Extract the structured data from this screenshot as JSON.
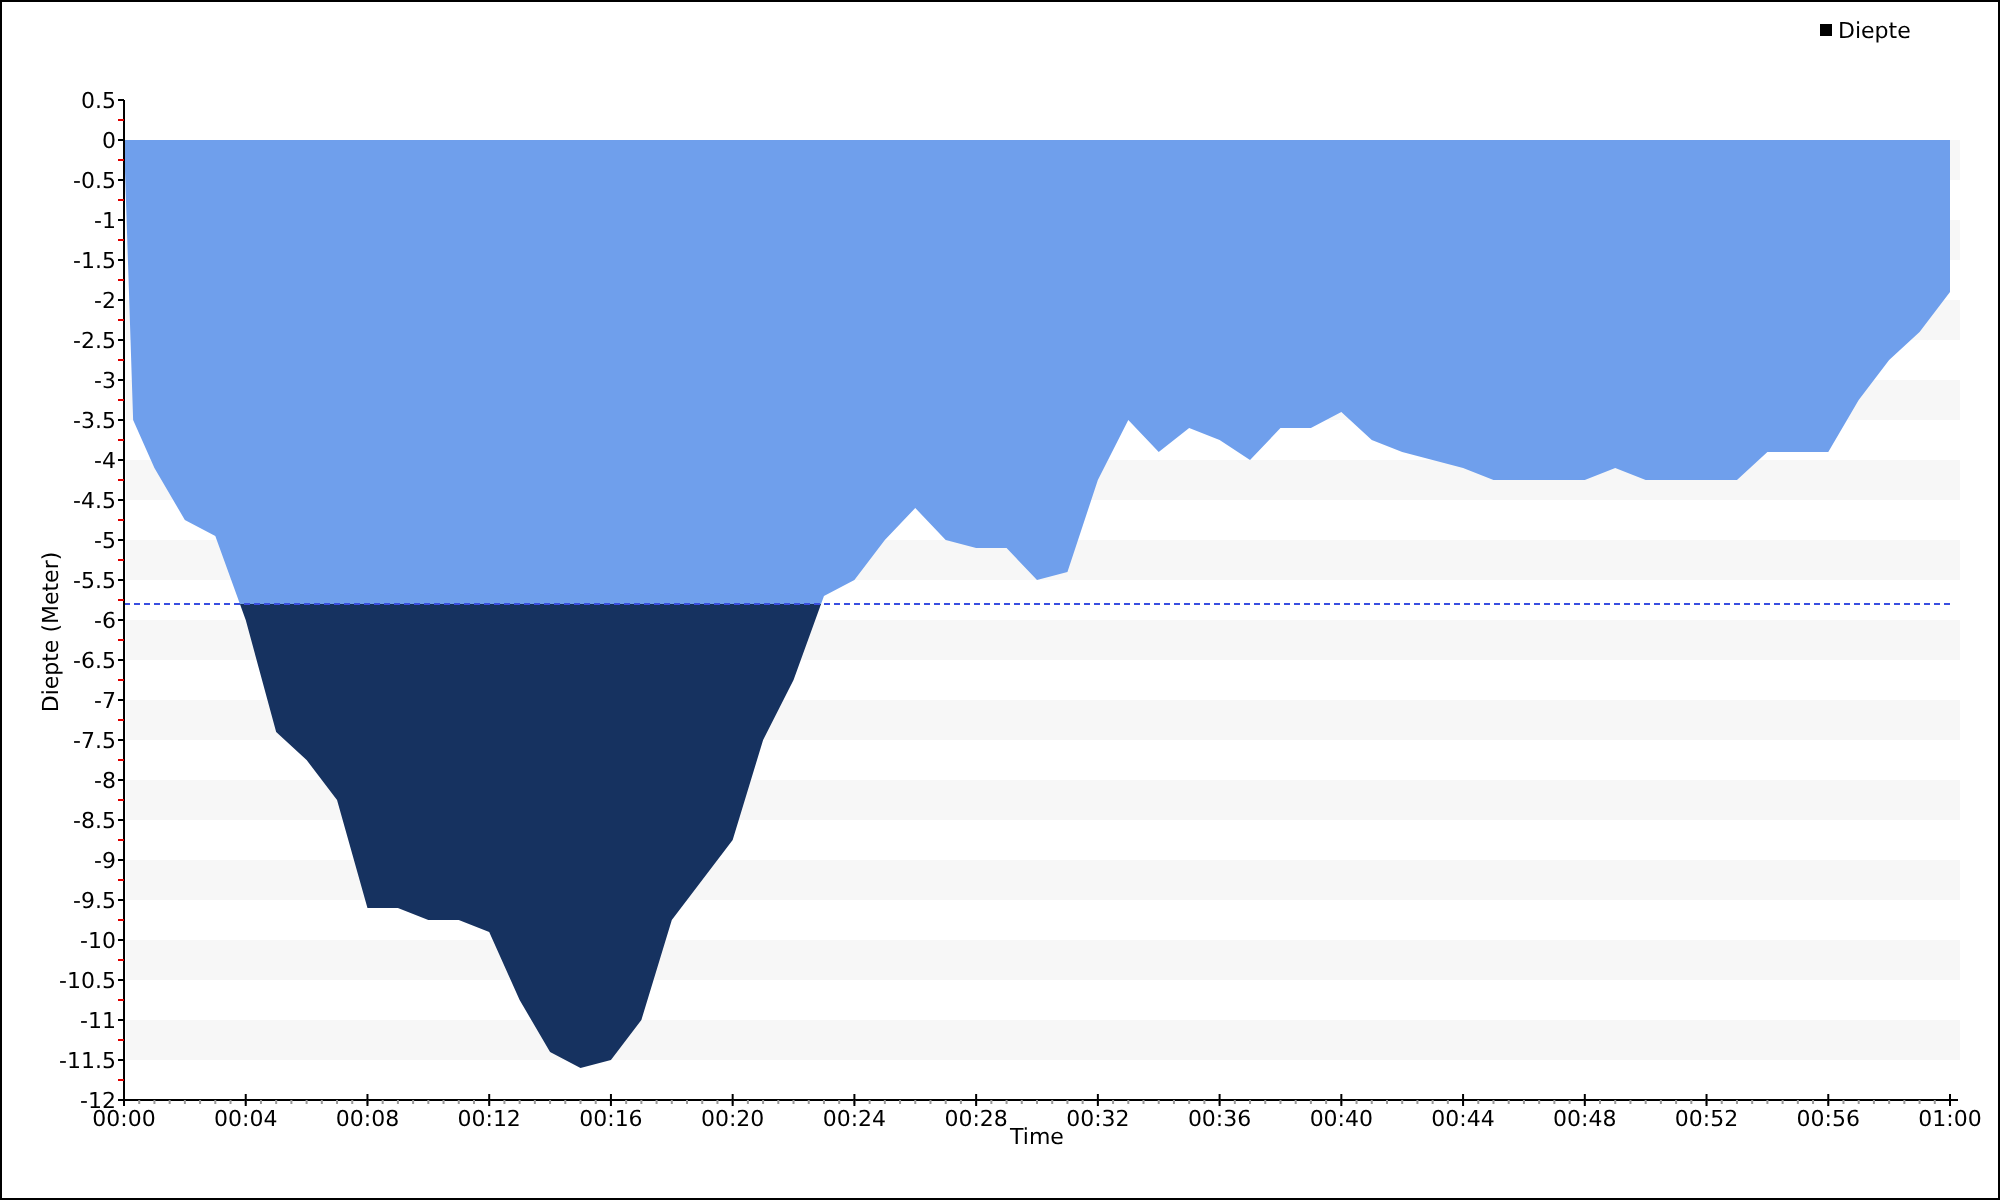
{
  "chart_data": {
    "type": "area",
    "xlabel": "Time",
    "ylabel": "Diepte (Meter)",
    "x": [
      0,
      0.3,
      1,
      2,
      3,
      4,
      5,
      6,
      7,
      8,
      9,
      10,
      11,
      12,
      13,
      14,
      15,
      16,
      17,
      18,
      19,
      20,
      21,
      22,
      23,
      24,
      25,
      26,
      27,
      28,
      29,
      30,
      31,
      32,
      33,
      34,
      35,
      36,
      37,
      38,
      39,
      40,
      41,
      42,
      43,
      44,
      45,
      46,
      47,
      48,
      49,
      50,
      51,
      52,
      53,
      54,
      55,
      56,
      57,
      58,
      59,
      60
    ],
    "series": [
      {
        "name": "Diepte",
        "color": "#6f9fec",
        "values": [
          0,
          -3.5,
          -4.1,
          -4.75,
          -4.95,
          -6.0,
          -7.4,
          -7.75,
          -8.25,
          -9.6,
          -9.6,
          -9.75,
          -9.75,
          -9.9,
          -10.75,
          -11.4,
          -11.6,
          -11.5,
          -11.0,
          -9.75,
          -9.25,
          -8.75,
          -7.5,
          -6.75,
          -5.7,
          -5.5,
          -5.0,
          -4.6,
          -5.0,
          -5.1,
          -5.1,
          -5.5,
          -5.4,
          -4.25,
          -3.5,
          -3.9,
          -3.6,
          -3.75,
          -4.0,
          -3.6,
          -3.6,
          -3.4,
          -3.75,
          -3.9,
          -4.0,
          -4.1,
          -4.25,
          -4.25,
          -4.25,
          -4.25,
          -4.1,
          -4.25,
          -4.25,
          -4.25,
          -4.25,
          -3.9,
          -3.9,
          -3.9,
          -3.25,
          -2.75,
          -2.4,
          -1.9
        ]
      }
    ],
    "xlim": [
      0,
      60
    ],
    "ylim": [
      -12,
      0.5
    ],
    "xticks": [
      {
        "value": 0,
        "label": "00:00"
      },
      {
        "value": 4,
        "label": "00:04"
      },
      {
        "value": 8,
        "label": "00:08"
      },
      {
        "value": 12,
        "label": "00:12"
      },
      {
        "value": 16,
        "label": "00:16"
      },
      {
        "value": 20,
        "label": "00:20"
      },
      {
        "value": 24,
        "label": "00:24"
      },
      {
        "value": 28,
        "label": "00:28"
      },
      {
        "value": 32,
        "label": "00:32"
      },
      {
        "value": 36,
        "label": "00:36"
      },
      {
        "value": 40,
        "label": "00:40"
      },
      {
        "value": 44,
        "label": "00:44"
      },
      {
        "value": 48,
        "label": "00:48"
      },
      {
        "value": 52,
        "label": "00:52"
      },
      {
        "value": 56,
        "label": "00:56"
      },
      {
        "value": 60,
        "label": "01:00"
      }
    ],
    "yticks": [
      0.5,
      0,
      -0.5,
      -1,
      -1.5,
      -2,
      -2.5,
      -3,
      -3.5,
      -4,
      -4.5,
      -5,
      -5.5,
      -6,
      -6.5,
      -7,
      -7.5,
      -8,
      -8.5,
      -9,
      -9.5,
      -10,
      -10.5,
      -11,
      -11.5,
      -12
    ],
    "ref_lines": [
      {
        "axis": "y",
        "value": -5.8
      }
    ]
  }
}
